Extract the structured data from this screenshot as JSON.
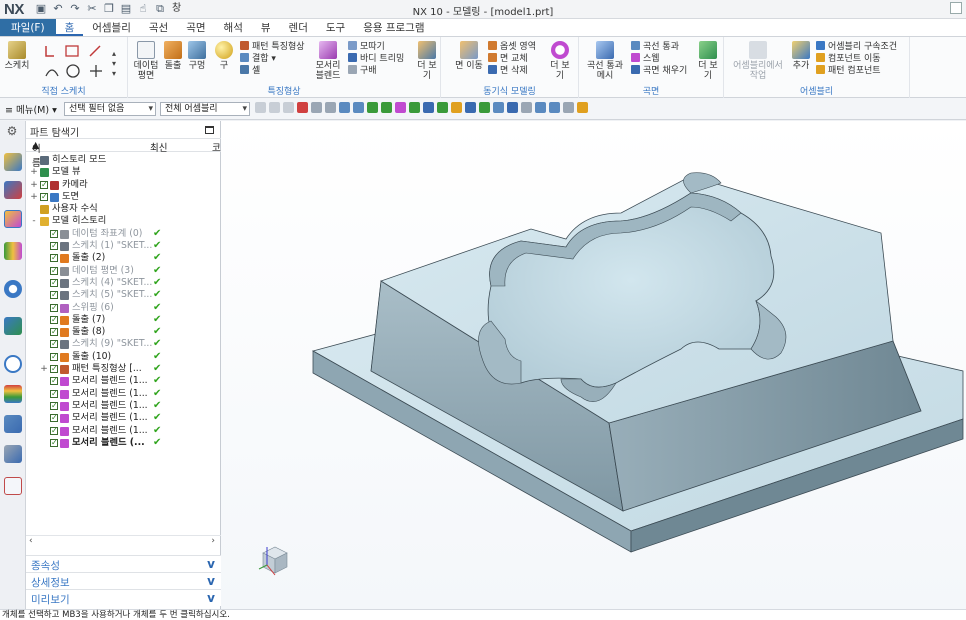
{
  "app": {
    "logo": "NX",
    "window_menu": "창",
    "title": "NX 10 - 모델링 - [model1.prt]"
  },
  "tabs": [
    {
      "label": "파일(F)"
    },
    {
      "label": "홈"
    },
    {
      "label": "어셈블리"
    },
    {
      "label": "곡선"
    },
    {
      "label": "곡면"
    },
    {
      "label": "해석"
    },
    {
      "label": "뷰"
    },
    {
      "label": "렌더"
    },
    {
      "label": "도구"
    },
    {
      "label": "응용 프로그램"
    }
  ],
  "ribbon": {
    "groups": {
      "direct_sketch": "직접 스케치",
      "feature": "특징형상",
      "sync_modeling": "동기식 모델링",
      "surface": "곡면",
      "assembly": "어셈블리"
    },
    "sketch": "스케치",
    "datum_plane": "데이텀 평면",
    "extrude": "돌출",
    "hole": "구멍",
    "sphere": "구",
    "pattern_feature": "패턴 특징형상",
    "unite": "결합",
    "shell": "셸",
    "edge_blend": "모서리 블렌드",
    "chamfer": "모따기",
    "trim_body": "바디 트리밍",
    "draft": "구배",
    "more1": "더 보기",
    "move_face": "면 이동",
    "offset_region": "옵셋 영역",
    "replace_face": "면 교체",
    "delete_face": "면 삭제",
    "more2": "더 보기",
    "through_curves": "곡선 통과",
    "swept": "스웹",
    "fill_surface": "곡면 채우기",
    "through_curve_mesh": "곡선 통과 메시",
    "more3": "더 보기",
    "from_assembly": "어셈블리에서 작업",
    "add": "추가",
    "assembly_constraints": "어셈블리 구속조건",
    "move_component": "컴포넌트 이동",
    "pattern_component": "패턴 컴포넌트"
  },
  "toolbar": {
    "menu": "메뉴(M)",
    "selection_filter": "선택 필터 없음",
    "scope": "전체 어셈블리"
  },
  "navigator": {
    "title": "파트 탐색기",
    "col_name": "이름",
    "col_latest": "최신",
    "col_extra": "코",
    "items": [
      {
        "label": "히스토리 모드",
        "check": false,
        "latest": "",
        "grey": false,
        "bold": false,
        "indent": 1,
        "exp": "",
        "color": "#5a6a7a"
      },
      {
        "label": "모델 뷰",
        "check": false,
        "latest": "",
        "grey": false,
        "bold": false,
        "indent": 1,
        "exp": "+",
        "color": "#2f8f4e"
      },
      {
        "label": "카메라",
        "check": true,
        "latest": "",
        "grey": false,
        "bold": false,
        "indent": 1,
        "exp": "+",
        "color": "#b03030"
      },
      {
        "label": "도면",
        "check": true,
        "latest": "",
        "grey": false,
        "bold": false,
        "indent": 1,
        "exp": "+",
        "color": "#3a78c4"
      },
      {
        "label": "사용자 수식",
        "check": false,
        "latest": "",
        "grey": false,
        "bold": false,
        "indent": 1,
        "exp": "",
        "color": "#d0a020"
      },
      {
        "label": "모델 히스토리",
        "check": false,
        "latest": "",
        "grey": false,
        "bold": false,
        "indent": 1,
        "exp": "-",
        "color": "#e0b030"
      },
      {
        "label": "데이텀 좌표계 (0)",
        "check": true,
        "latest": "✔",
        "grey": true,
        "bold": false,
        "indent": 2,
        "exp": "",
        "color": "#8a8f96"
      },
      {
        "label": "스케치 (1) \"SKET...",
        "check": true,
        "latest": "✔",
        "grey": true,
        "bold": false,
        "indent": 2,
        "exp": "",
        "color": "#6b7480"
      },
      {
        "label": "돌출 (2)",
        "check": true,
        "latest": "✔",
        "grey": false,
        "bold": false,
        "indent": 2,
        "exp": "",
        "color": "#e07a20"
      },
      {
        "label": "데이텀 평면 (3)",
        "check": true,
        "latest": "✔",
        "grey": true,
        "bold": false,
        "indent": 2,
        "exp": "",
        "color": "#8a8f96"
      },
      {
        "label": "스케치 (4) \"SKET...",
        "check": true,
        "latest": "✔",
        "grey": true,
        "bold": false,
        "indent": 2,
        "exp": "",
        "color": "#6b7480"
      },
      {
        "label": "스케치 (5) \"SKET...",
        "check": true,
        "latest": "✔",
        "grey": true,
        "bold": false,
        "indent": 2,
        "exp": "",
        "color": "#6b7480"
      },
      {
        "label": "스위핑 (6)",
        "check": true,
        "latest": "✔",
        "grey": true,
        "bold": false,
        "indent": 2,
        "exp": "",
        "color": "#b060c0"
      },
      {
        "label": "돌출 (7)",
        "check": true,
        "latest": "✔",
        "grey": false,
        "bold": false,
        "indent": 2,
        "exp": "",
        "color": "#e07a20"
      },
      {
        "label": "돌출 (8)",
        "check": true,
        "latest": "✔",
        "grey": false,
        "bold": false,
        "indent": 2,
        "exp": "",
        "color": "#e07a20"
      },
      {
        "label": "스케치 (9) \"SKET...",
        "check": true,
        "latest": "✔",
        "grey": true,
        "bold": false,
        "indent": 2,
        "exp": "",
        "color": "#6b7480"
      },
      {
        "label": "돌출 (10)",
        "check": true,
        "latest": "✔",
        "grey": false,
        "bold": false,
        "indent": 2,
        "exp": "",
        "color": "#e07a20"
      },
      {
        "label": "패턴 특징형상 [...",
        "check": true,
        "latest": "✔",
        "grey": false,
        "bold": false,
        "indent": 2,
        "exp": "+",
        "color": "#c05a30"
      },
      {
        "label": "모서리 블렌드 (1...",
        "check": true,
        "latest": "✔",
        "grey": false,
        "bold": false,
        "indent": 2,
        "exp": "",
        "color": "#c04ad0"
      },
      {
        "label": "모서리 블렌드 (1...",
        "check": true,
        "latest": "✔",
        "grey": false,
        "bold": false,
        "indent": 2,
        "exp": "",
        "color": "#c04ad0"
      },
      {
        "label": "모서리 블렌드 (1...",
        "check": true,
        "latest": "✔",
        "grey": false,
        "bold": false,
        "indent": 2,
        "exp": "",
        "color": "#c04ad0"
      },
      {
        "label": "모서리 블렌드 (1...",
        "check": true,
        "latest": "✔",
        "grey": false,
        "bold": false,
        "indent": 2,
        "exp": "",
        "color": "#c04ad0"
      },
      {
        "label": "모서리 블렌드 (1...",
        "check": true,
        "latest": "✔",
        "grey": false,
        "bold": false,
        "indent": 2,
        "exp": "",
        "color": "#c04ad0"
      },
      {
        "label": "모서리 블렌드 (...",
        "check": true,
        "latest": "✔",
        "grey": false,
        "bold": true,
        "indent": 2,
        "exp": "",
        "color": "#c04ad0"
      }
    ],
    "panels": [
      {
        "label": "종속성"
      },
      {
        "label": "상세정보"
      },
      {
        "label": "미리보기"
      }
    ]
  },
  "status": "개체를 선택하고 MB3을 사용하거나 개체를 두 번 클릭하십시오.",
  "colors": {
    "file_tab": "#2f6ea5",
    "accent": "#2b66b0",
    "model_light": "#cfe3ec",
    "model_dark": "#7f97a3",
    "latest_check": "#31a51e"
  }
}
